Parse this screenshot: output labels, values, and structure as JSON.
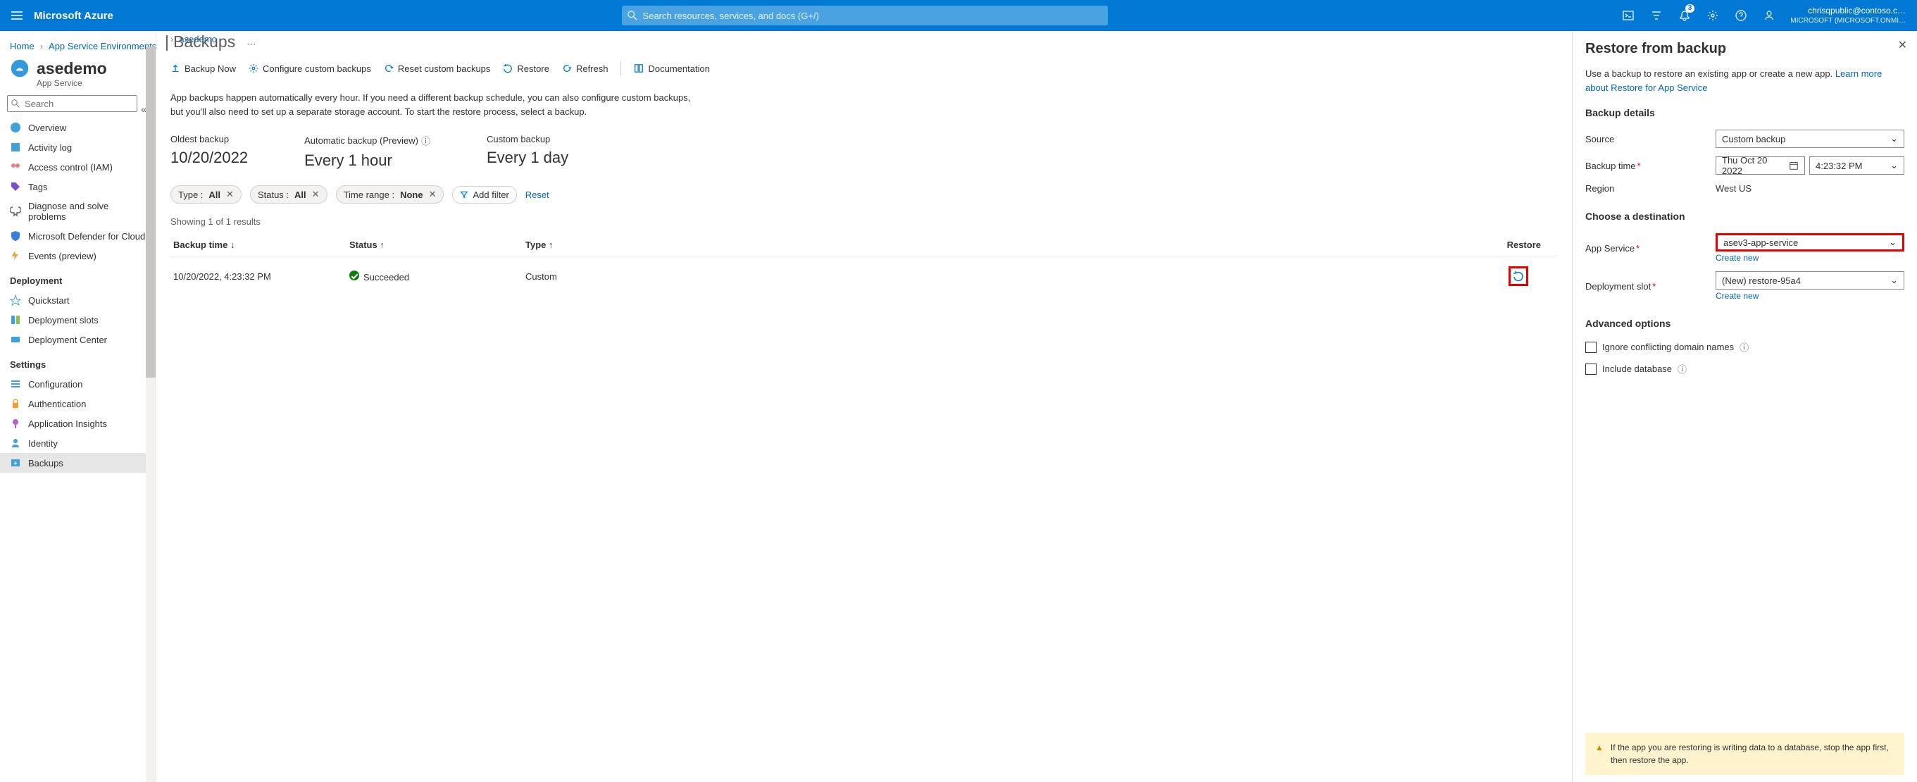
{
  "brand": "Microsoft Azure",
  "search_placeholder": "Search resources, services, and docs (G+/)",
  "notification_count": "3",
  "account": {
    "email": "chrisqpublic@contoso.c…",
    "tenant": "MICROSOFT (MICROSOFT.ONMI…"
  },
  "breadcrumb": {
    "home": "Home",
    "l1": "App Service Environments",
    "l2": "asedemo"
  },
  "page": {
    "name": "asedemo",
    "section": "Backups",
    "service": "App Service"
  },
  "sidebar": {
    "search_placeholder": "Search",
    "items": [
      {
        "label": "Overview",
        "icon": "#40a0d8"
      },
      {
        "label": "Activity log",
        "icon": "#40a0d8"
      },
      {
        "label": "Access control (IAM)",
        "icon": "#e08090"
      },
      {
        "label": "Tags",
        "icon": "#7a50c8"
      },
      {
        "label": "Diagnose and solve problems",
        "icon": "#666"
      },
      {
        "label": "Microsoft Defender for Cloud",
        "icon": "#3a80d8"
      },
      {
        "label": "Events (preview)",
        "icon": "#f0a030"
      }
    ],
    "head_deploy": "Deployment",
    "deploy": [
      {
        "label": "Quickstart"
      },
      {
        "label": "Deployment slots"
      },
      {
        "label": "Deployment Center"
      }
    ],
    "head_settings": "Settings",
    "settings": [
      {
        "label": "Configuration"
      },
      {
        "label": "Authentication"
      },
      {
        "label": "Application Insights"
      },
      {
        "label": "Identity"
      },
      {
        "label": "Backups"
      }
    ]
  },
  "toolbar": {
    "backup_now": "Backup Now",
    "configure": "Configure custom backups",
    "reset": "Reset custom backups",
    "restore": "Restore",
    "refresh": "Refresh",
    "docs": "Documentation"
  },
  "info": "App backups happen automatically every hour. If you need a different backup schedule, you can also configure custom backups, but you'll also need to set up a separate storage account. To start the restore process, select a backup.",
  "stats": {
    "oldest_l": "Oldest backup",
    "oldest_v": "10/20/2022",
    "auto_l": "Automatic backup (Preview)",
    "auto_v": "Every 1 hour",
    "custom_l": "Custom backup",
    "custom_v": "Every 1 day"
  },
  "filters": {
    "type_l": "Type : ",
    "type_v": "All",
    "status_l": "Status : ",
    "status_v": "All",
    "range_l": "Time range : ",
    "range_v": "None",
    "add": "Add filter",
    "reset": "Reset"
  },
  "results_count": "Showing 1 of 1 results",
  "table": {
    "h_time": "Backup time",
    "h_status": "Status",
    "h_type": "Type",
    "h_restore": "Restore",
    "rows": [
      {
        "time": "10/20/2022, 4:23:32 PM",
        "status": "Succeeded",
        "type": "Custom"
      }
    ]
  },
  "panel": {
    "title": "Restore from backup",
    "desc": "Use a backup to restore an existing app or create a new app. ",
    "desc_link": "Learn more about Restore for App Service",
    "sec_backup": "Backup details",
    "source_l": "Source",
    "source_v": "Custom backup",
    "time_l": "Backup time",
    "date_v": "Thu Oct 20 2022",
    "time_v": "4:23:32 PM",
    "region_l": "Region",
    "region_v": "West US",
    "sec_dest": "Choose a destination",
    "app_l": "App Service",
    "app_v": "asev3-app-service",
    "create": "Create new",
    "slot_l": "Deployment slot",
    "slot_v": "(New) restore-95a4",
    "sec_adv": "Advanced options",
    "opt1": "Ignore conflicting domain names",
    "opt2": "Include database",
    "alert": "If the app you are restoring is writing data to a database, stop the app first, then restore the app."
  }
}
